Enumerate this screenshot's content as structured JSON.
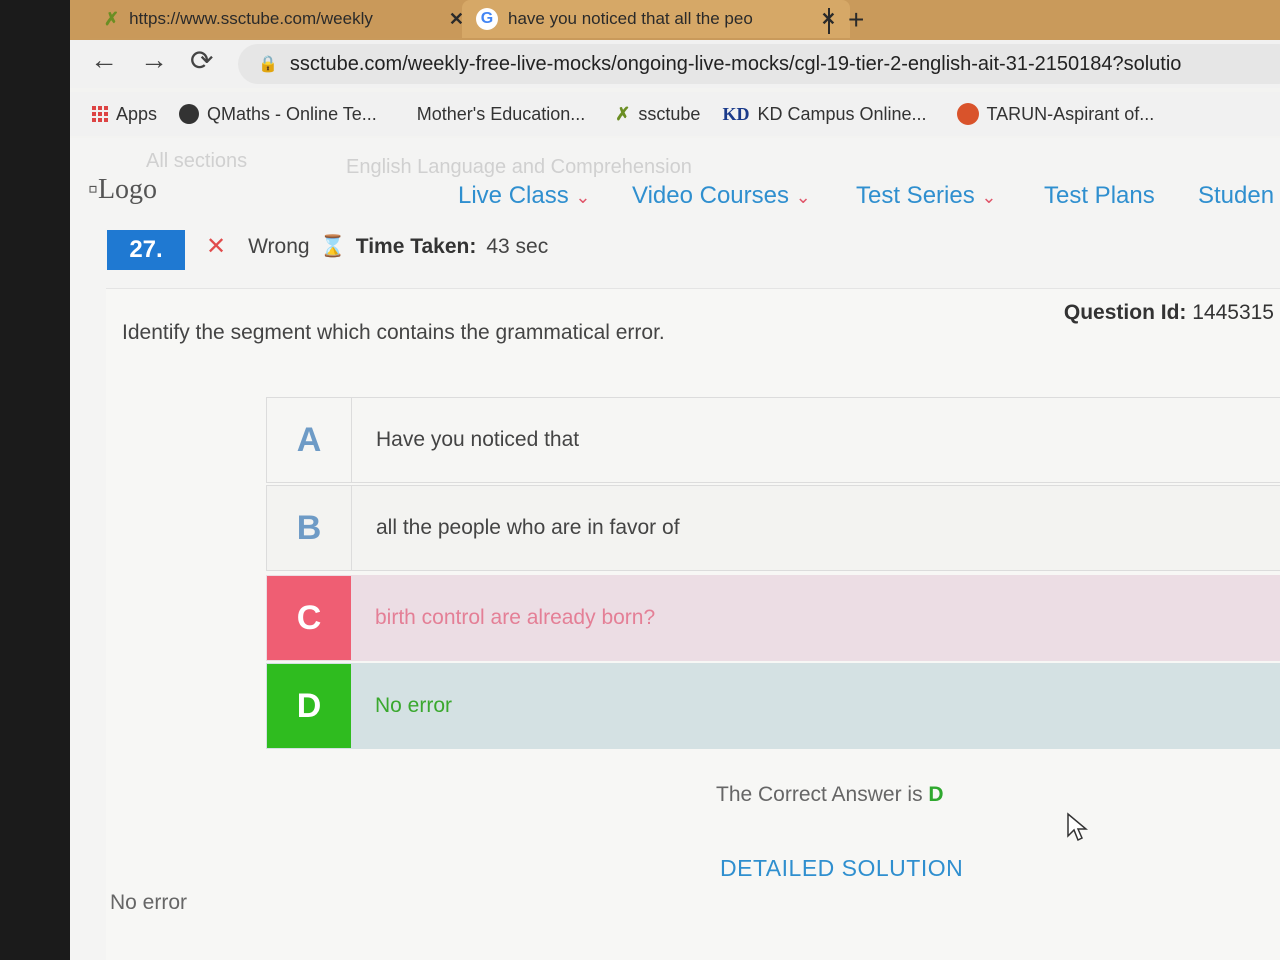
{
  "tabs": [
    {
      "title": "https://www.ssctube.com/weekly",
      "close": "✕"
    },
    {
      "title": "have you noticed that all the peo",
      "close": "✕"
    }
  ],
  "new_tab": "+",
  "toolbar": {
    "back": "←",
    "forward": "→",
    "reload": "⟳",
    "url": "ssctube.com/weekly-free-live-mocks/ongoing-live-mocks/cgl-19-tier-2-english-ait-31-2150184?solutio"
  },
  "bookmarks": [
    {
      "label": "Apps"
    },
    {
      "label": "QMaths - Online Te..."
    },
    {
      "label": "Mother's Education..."
    },
    {
      "label": "ssctube"
    },
    {
      "label": "KD Campus Online..."
    },
    {
      "label": "TARUN-Aspirant of..."
    }
  ],
  "header": {
    "all_sections": "All sections",
    "section_name": "English Language and Comprehension",
    "logo_alt": "Logo",
    "nav": [
      "Live Class",
      "Video Courses",
      "Test Series",
      "Test Plans",
      "Studen"
    ]
  },
  "question": {
    "number": "27.",
    "status": "Wrong",
    "time_label": "Time Taken:",
    "time_value": "43 sec",
    "id_label": "Question Id:",
    "id_value": "1445315",
    "text": "Identify the segment which contains the grammatical error.",
    "options": [
      {
        "letter": "A",
        "text": "Have you noticed that"
      },
      {
        "letter": "B",
        "text": "all the people who are in favor of"
      },
      {
        "letter": "C",
        "text": "birth control are already born?"
      },
      {
        "letter": "D",
        "text": "No error"
      }
    ],
    "correct_label": "The Correct Answer is",
    "correct_value": "D",
    "solution_button": "DETAILED SOLUTION",
    "bottom_note": "No error"
  },
  "colors": {
    "accent": "#2f8fcf",
    "wrong": "#ef5e73",
    "correct": "#2fbc1f",
    "qnum_bg": "#1f79d2"
  }
}
